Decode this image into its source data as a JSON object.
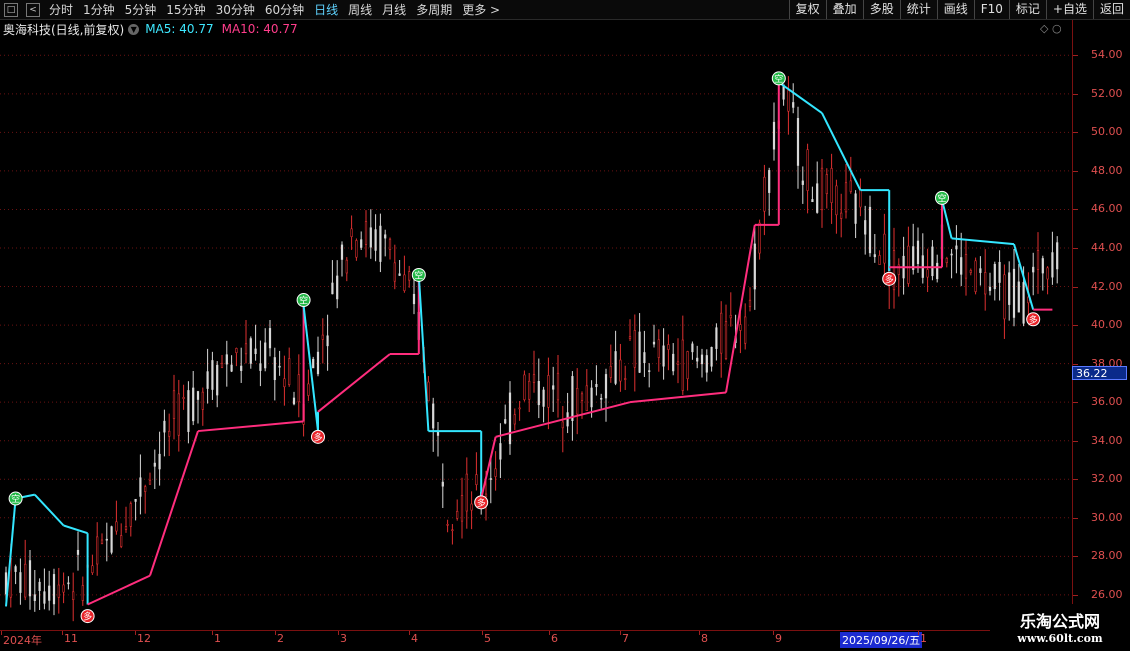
{
  "toolbar": {
    "left_buttons": [
      "□",
      "<"
    ],
    "periods": [
      "分时",
      "1分钟",
      "5分钟",
      "15分钟",
      "30分钟",
      "60分钟",
      "日线",
      "周线",
      "月线",
      "多周期",
      "更多 >"
    ],
    "active_period": "日线",
    "right_buttons": [
      "复权",
      "叠加",
      "多股",
      "统计",
      "画线",
      "F10",
      "标记",
      "+自选",
      "返回"
    ]
  },
  "title": {
    "stock": "奥海科技(日线,前复权)",
    "ma5": "MA5: 40.77",
    "ma10": "MA10: 40.77"
  },
  "colors": {
    "up": "#ff3232",
    "down": "#00e0e0",
    "line_up": "#ff2d7d",
    "line_down": "#33e6ff",
    "bg": "#000000"
  },
  "chart_data": {
    "type": "candlestick-with-stepline",
    "y_ticks": [
      "54.00",
      "52.00",
      "50.00",
      "48.00",
      "46.00",
      "44.00",
      "42.00",
      "40.00",
      "38.00",
      "36.00",
      "34.00",
      "32.00",
      "30.00",
      "28.00",
      "26.00"
    ],
    "ylim": [
      24.8,
      55.0
    ],
    "current_price": "36.22",
    "x_labels": [
      "2024年",
      "11",
      "12",
      "1",
      "2",
      "3",
      "4",
      "5",
      "6",
      "7",
      "8",
      "9",
      "1"
    ],
    "cursor_date": "2025/09/26/五",
    "markers": [
      {
        "label": "空",
        "x_index": 2,
        "price": 31.0
      },
      {
        "label": "多",
        "x_index": 17,
        "price": 24.9
      },
      {
        "label": "空",
        "x_index": 62,
        "price": 41.3
      },
      {
        "label": "多",
        "x_index": 65,
        "price": 34.2
      },
      {
        "label": "空",
        "x_index": 86,
        "price": 42.6
      },
      {
        "label": "多",
        "x_index": 99,
        "price": 30.8
      },
      {
        "label": "空",
        "x_index": 161,
        "price": 52.8
      },
      {
        "label": "多",
        "x_index": 184,
        "price": 42.4
      },
      {
        "label": "空",
        "x_index": 195,
        "price": 46.6
      },
      {
        "label": "多",
        "x_index": 214,
        "price": 40.3
      }
    ]
  },
  "watermark": {
    "title": "乐淘公式网",
    "url": "www.60lt.com"
  }
}
